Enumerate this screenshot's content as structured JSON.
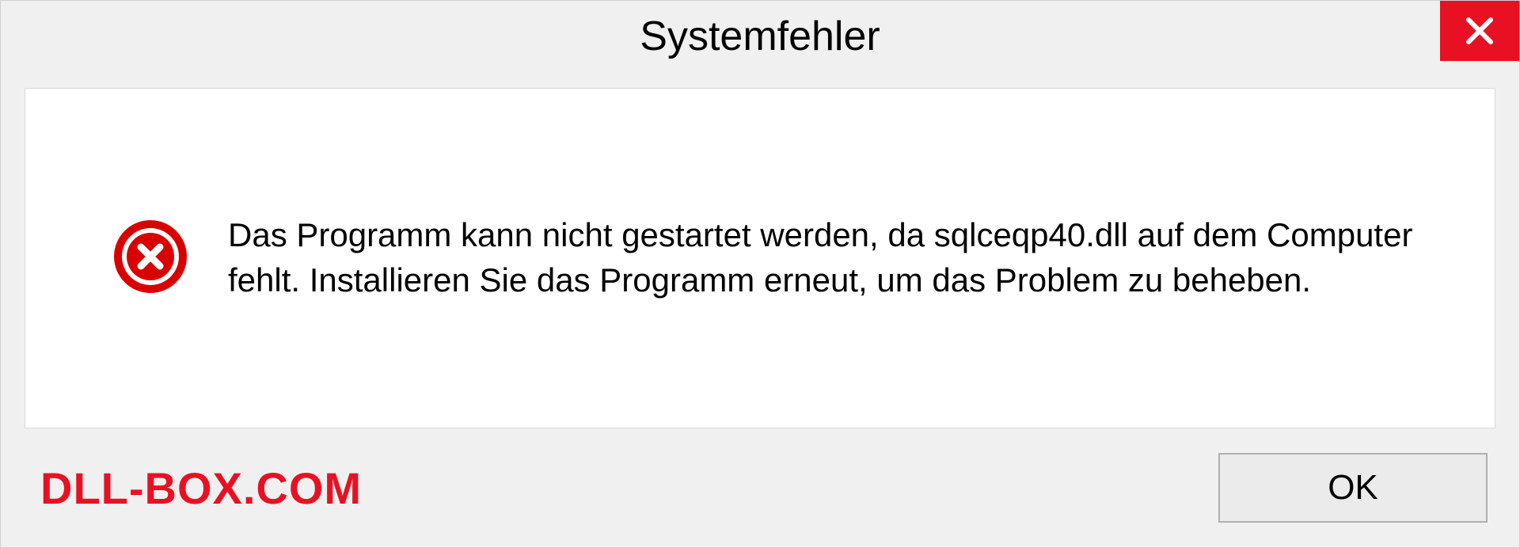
{
  "dialog": {
    "title": "Systemfehler",
    "message": "Das Programm kann nicht gestartet werden, da sqlceqp40.dll auf dem Computer fehlt. Installieren Sie das Programm erneut, um das Problem zu beheben.",
    "ok_label": "OK"
  },
  "watermark": "DLL-BOX.COM"
}
